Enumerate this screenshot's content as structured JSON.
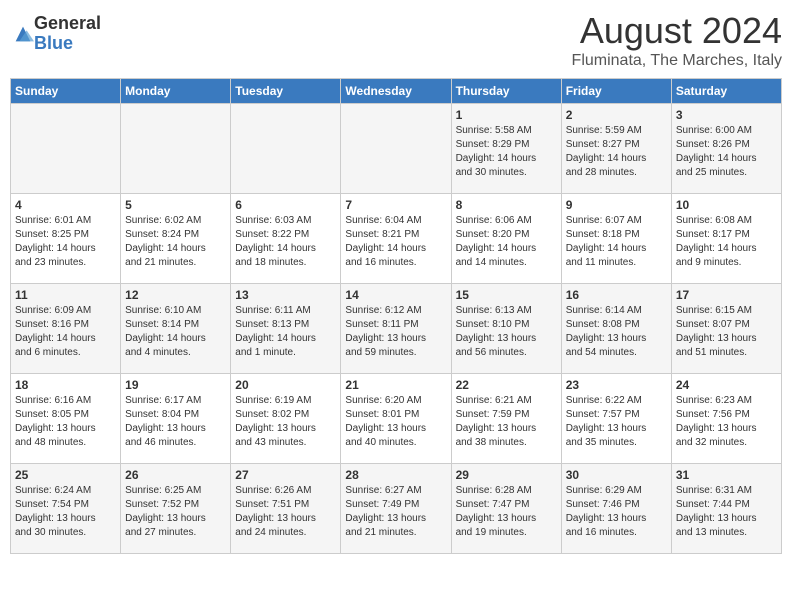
{
  "logo": {
    "general": "General",
    "blue": "Blue"
  },
  "header": {
    "month": "August 2024",
    "location": "Fluminata, The Marches, Italy"
  },
  "days_of_week": [
    "Sunday",
    "Monday",
    "Tuesday",
    "Wednesday",
    "Thursday",
    "Friday",
    "Saturday"
  ],
  "weeks": [
    [
      {
        "day": "",
        "info": ""
      },
      {
        "day": "",
        "info": ""
      },
      {
        "day": "",
        "info": ""
      },
      {
        "day": "",
        "info": ""
      },
      {
        "day": "1",
        "info": "Sunrise: 5:58 AM\nSunset: 8:29 PM\nDaylight: 14 hours\nand 30 minutes."
      },
      {
        "day": "2",
        "info": "Sunrise: 5:59 AM\nSunset: 8:27 PM\nDaylight: 14 hours\nand 28 minutes."
      },
      {
        "day": "3",
        "info": "Sunrise: 6:00 AM\nSunset: 8:26 PM\nDaylight: 14 hours\nand 25 minutes."
      }
    ],
    [
      {
        "day": "4",
        "info": "Sunrise: 6:01 AM\nSunset: 8:25 PM\nDaylight: 14 hours\nand 23 minutes."
      },
      {
        "day": "5",
        "info": "Sunrise: 6:02 AM\nSunset: 8:24 PM\nDaylight: 14 hours\nand 21 minutes."
      },
      {
        "day": "6",
        "info": "Sunrise: 6:03 AM\nSunset: 8:22 PM\nDaylight: 14 hours\nand 18 minutes."
      },
      {
        "day": "7",
        "info": "Sunrise: 6:04 AM\nSunset: 8:21 PM\nDaylight: 14 hours\nand 16 minutes."
      },
      {
        "day": "8",
        "info": "Sunrise: 6:06 AM\nSunset: 8:20 PM\nDaylight: 14 hours\nand 14 minutes."
      },
      {
        "day": "9",
        "info": "Sunrise: 6:07 AM\nSunset: 8:18 PM\nDaylight: 14 hours\nand 11 minutes."
      },
      {
        "day": "10",
        "info": "Sunrise: 6:08 AM\nSunset: 8:17 PM\nDaylight: 14 hours\nand 9 minutes."
      }
    ],
    [
      {
        "day": "11",
        "info": "Sunrise: 6:09 AM\nSunset: 8:16 PM\nDaylight: 14 hours\nand 6 minutes."
      },
      {
        "day": "12",
        "info": "Sunrise: 6:10 AM\nSunset: 8:14 PM\nDaylight: 14 hours\nand 4 minutes."
      },
      {
        "day": "13",
        "info": "Sunrise: 6:11 AM\nSunset: 8:13 PM\nDaylight: 14 hours\nand 1 minute."
      },
      {
        "day": "14",
        "info": "Sunrise: 6:12 AM\nSunset: 8:11 PM\nDaylight: 13 hours\nand 59 minutes."
      },
      {
        "day": "15",
        "info": "Sunrise: 6:13 AM\nSunset: 8:10 PM\nDaylight: 13 hours\nand 56 minutes."
      },
      {
        "day": "16",
        "info": "Sunrise: 6:14 AM\nSunset: 8:08 PM\nDaylight: 13 hours\nand 54 minutes."
      },
      {
        "day": "17",
        "info": "Sunrise: 6:15 AM\nSunset: 8:07 PM\nDaylight: 13 hours\nand 51 minutes."
      }
    ],
    [
      {
        "day": "18",
        "info": "Sunrise: 6:16 AM\nSunset: 8:05 PM\nDaylight: 13 hours\nand 48 minutes."
      },
      {
        "day": "19",
        "info": "Sunrise: 6:17 AM\nSunset: 8:04 PM\nDaylight: 13 hours\nand 46 minutes."
      },
      {
        "day": "20",
        "info": "Sunrise: 6:19 AM\nSunset: 8:02 PM\nDaylight: 13 hours\nand 43 minutes."
      },
      {
        "day": "21",
        "info": "Sunrise: 6:20 AM\nSunset: 8:01 PM\nDaylight: 13 hours\nand 40 minutes."
      },
      {
        "day": "22",
        "info": "Sunrise: 6:21 AM\nSunset: 7:59 PM\nDaylight: 13 hours\nand 38 minutes."
      },
      {
        "day": "23",
        "info": "Sunrise: 6:22 AM\nSunset: 7:57 PM\nDaylight: 13 hours\nand 35 minutes."
      },
      {
        "day": "24",
        "info": "Sunrise: 6:23 AM\nSunset: 7:56 PM\nDaylight: 13 hours\nand 32 minutes."
      }
    ],
    [
      {
        "day": "25",
        "info": "Sunrise: 6:24 AM\nSunset: 7:54 PM\nDaylight: 13 hours\nand 30 minutes."
      },
      {
        "day": "26",
        "info": "Sunrise: 6:25 AM\nSunset: 7:52 PM\nDaylight: 13 hours\nand 27 minutes."
      },
      {
        "day": "27",
        "info": "Sunrise: 6:26 AM\nSunset: 7:51 PM\nDaylight: 13 hours\nand 24 minutes."
      },
      {
        "day": "28",
        "info": "Sunrise: 6:27 AM\nSunset: 7:49 PM\nDaylight: 13 hours\nand 21 minutes."
      },
      {
        "day": "29",
        "info": "Sunrise: 6:28 AM\nSunset: 7:47 PM\nDaylight: 13 hours\nand 19 minutes."
      },
      {
        "day": "30",
        "info": "Sunrise: 6:29 AM\nSunset: 7:46 PM\nDaylight: 13 hours\nand 16 minutes."
      },
      {
        "day": "31",
        "info": "Sunrise: 6:31 AM\nSunset: 7:44 PM\nDaylight: 13 hours\nand 13 minutes."
      }
    ]
  ]
}
